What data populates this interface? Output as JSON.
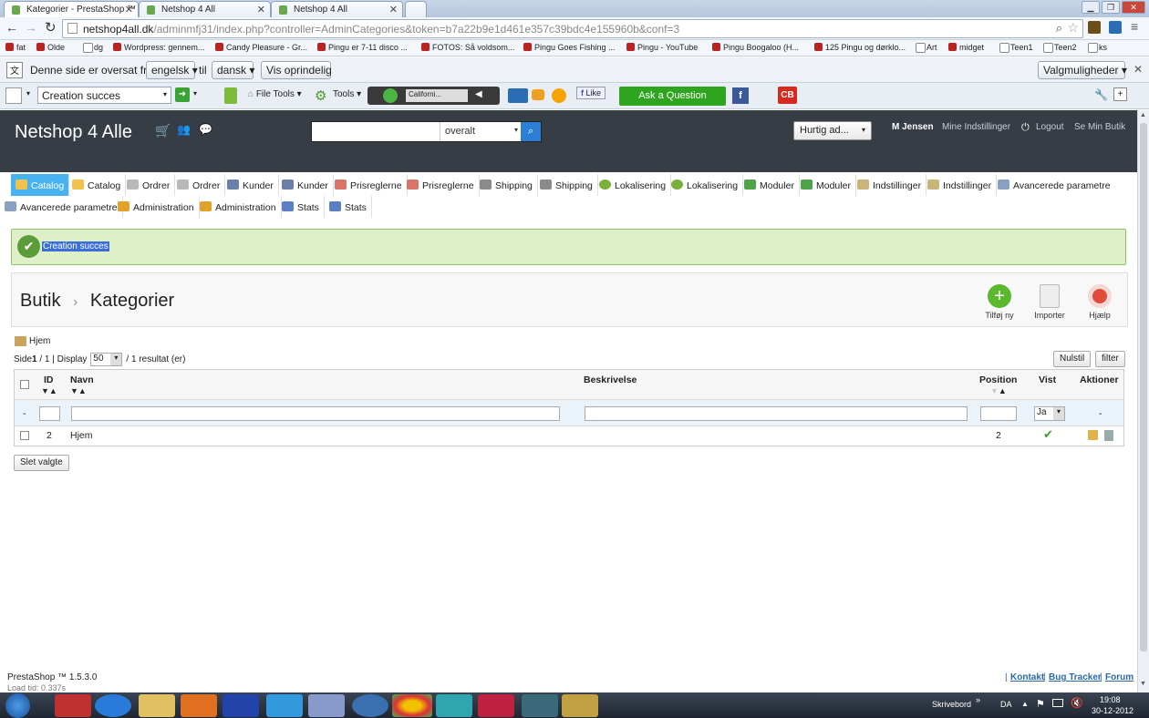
{
  "browser": {
    "tabs": [
      "Kategorier - PrestaShop ™",
      "Netshop 4 All",
      "Netshop 4 All"
    ],
    "url_main": "netshop4all.dk",
    "url_rest": "/adminmfj31/index.php?controller=AdminCategories&token=b7a22b9e1d461e357c39bdc4e155960b&conf=3"
  },
  "bookmarks": [
    "fat",
    "Olde",
    "dg",
    "Wordpress: gennem...",
    "Candy Pleasure - Gr...",
    "Pingu er 7-11 disco ...",
    "FOTOS: Så voldsom...",
    "Pingu Goes Fishing ...",
    "Pingu - YouTube",
    "Pingu Boogaloo (H...",
    "125 Pingu og dørklo...",
    "Art",
    "midget",
    "Teen1",
    "Teen2",
    "ks"
  ],
  "translate": {
    "text": "Denne side er oversat fra",
    "from": "engelsk",
    "to_label": "til",
    "to": "dansk",
    "show_original": "Vis oprindelig",
    "options": "Valgmuligheder"
  },
  "toolbar": {
    "search_value": "Creation succes",
    "file_tools": "File Tools",
    "tools": "Tools",
    "player": "Californi...",
    "like": "Like",
    "ask": "Ask a Question",
    "cb": "CB"
  },
  "header": {
    "brand": "Netshop 4 Alle",
    "search_scope": "overalt",
    "quick": "Hurtig ad...",
    "user": "M Jensen",
    "settings": "Mine Indstillinger",
    "logout": "Logout",
    "view_shop": "Se Min Butik"
  },
  "menu": [
    "Catalog",
    "Catalog",
    "Ordrer",
    "Ordrer",
    "Kunder",
    "Kunder",
    "Prisreglerne",
    "Prisreglerne",
    "Shipping",
    "Shipping",
    "Lokalisering",
    "Lokalisering",
    "Moduler",
    "Moduler",
    "Indstillinger",
    "Indstillinger",
    "Avancerede parametre",
    "Avancerede parametre",
    "Administration",
    "Administration",
    "Stats",
    "Stats"
  ],
  "success": "Creation succes",
  "page": {
    "crumb1": "Butik",
    "sep": "›",
    "crumb2": "Kategorier",
    "add": "Tilføj ny",
    "import": "Importer",
    "help": "Hjælp"
  },
  "list": {
    "home": "Hjem",
    "pagination_pre": "Side ",
    "page_cur": "1",
    "pagination_mid": " / 1 | Display",
    "per_page": "50",
    "results": "/ 1 resultat (er)",
    "reset": "Nulstil",
    "filter": "filter",
    "columns": {
      "id": "ID",
      "name": "Navn",
      "desc": "Beskrivelse",
      "position": "Position",
      "shown": "Vist",
      "actions": "Aktioner"
    },
    "filter_dash": "-",
    "filter_vist": "Ja",
    "filter_actions": "-",
    "rows": [
      {
        "id": "2",
        "name": "Hjem",
        "position": "2"
      }
    ],
    "delete_selected": "Slet valgte"
  },
  "footer": {
    "version": "PrestaShop ™ 1.5.3.0",
    "load": "Load tid: 0.337s",
    "contact": "Kontakt",
    "bug": "Bug Tracker",
    "forum": "Forum",
    "pipe": "|"
  },
  "taskbar": {
    "desktop": "Skrivebord",
    "lang": "DA",
    "time": "19:08",
    "date": "30-12-2012"
  }
}
